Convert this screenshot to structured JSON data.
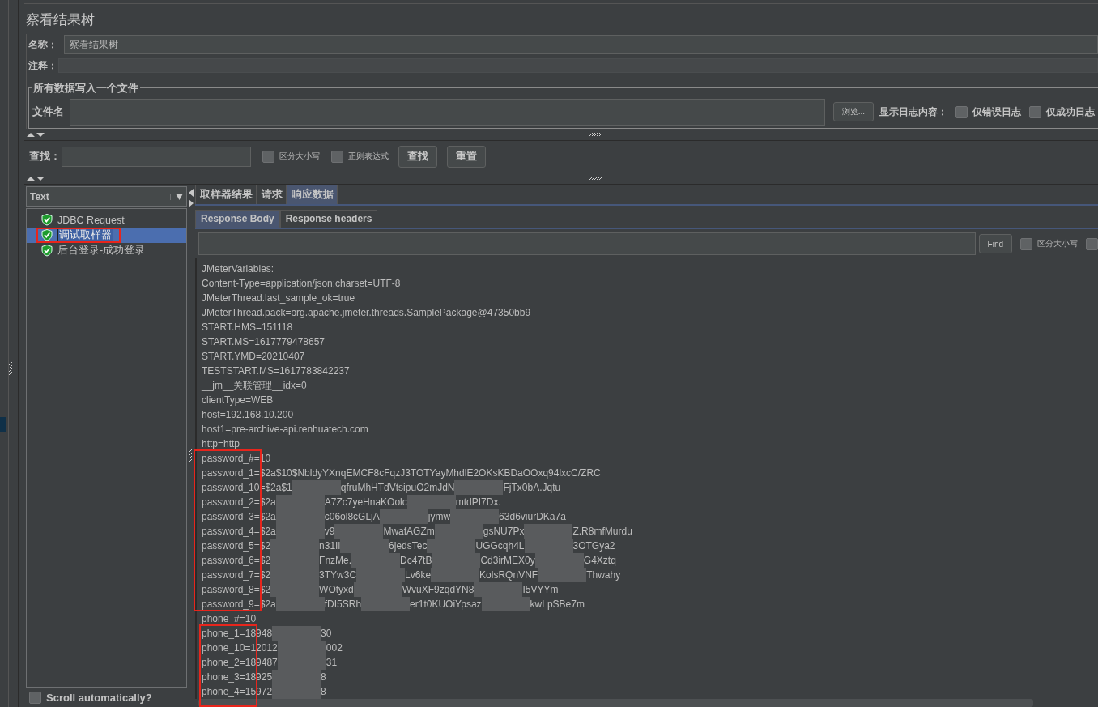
{
  "title": "察看结果树",
  "name_field": {
    "label": "名称：",
    "value": "察看结果树"
  },
  "comment_field": {
    "label": "注释："
  },
  "file_group": {
    "legend": "所有数据写入一个文件",
    "label": "文件名",
    "browse_button": "浏览...",
    "log_label": "显示日志内容：",
    "options": [
      {
        "label": "仅错误日志",
        "checked": false
      },
      {
        "label": "仅成功日志",
        "checked": false
      }
    ]
  },
  "search": {
    "label": "查找：",
    "options": [
      {
        "label": "区分大小写",
        "checked": false
      },
      {
        "label": "正则表达式",
        "checked": false
      }
    ],
    "buttons": [
      "查找",
      "重置"
    ]
  },
  "renderer": {
    "value": "Text"
  },
  "tree": [
    {
      "label": "JDBC Request",
      "passed": true,
      "selected": false,
      "highlighted": false
    },
    {
      "label": "调试取样器",
      "passed": true,
      "selected": true,
      "highlighted": true
    },
    {
      "label": "后台登录-成功登录",
      "passed": true,
      "selected": false,
      "highlighted": false
    }
  ],
  "scroll_auto": {
    "label": "Scroll automatically?",
    "checked": false
  },
  "tabs": [
    {
      "label": "取样器结果",
      "selected": false
    },
    {
      "label": "请求",
      "selected": false
    },
    {
      "label": "响应数据",
      "selected": true
    }
  ],
  "subtabs": [
    {
      "label": "Response Body",
      "selected": true
    },
    {
      "label": "Response headers",
      "selected": false
    }
  ],
  "find": {
    "button": "Find",
    "options": [
      {
        "label": "区分大小写",
        "checked": false
      },
      {
        "checked": false
      }
    ]
  },
  "response_blocks": [
    {
      "marked": false,
      "lines": [
        {
          "parts": [
            "JMeterVariables:"
          ]
        },
        {
          "parts": [
            "Content-Type=application/json;charset=UTF-8"
          ]
        },
        {
          "parts": [
            "JMeterThread.last_sample_ok=true"
          ]
        },
        {
          "parts": [
            "JMeterThread.pack=org.apache.jmeter.threads.SamplePackage@47350bb9"
          ]
        },
        {
          "parts": [
            "START.HMS=151118"
          ]
        },
        {
          "parts": [
            "START.MS=1617779478657"
          ]
        },
        {
          "parts": [
            "START.YMD=20210407"
          ]
        },
        {
          "parts": [
            "TESTSTART.MS=1617783842237"
          ]
        },
        {
          "parts": [
            "__jm__关联管理__idx=0"
          ]
        },
        {
          "parts": [
            "clientType=WEB"
          ]
        },
        {
          "parts": [
            "host=192.168.10.200"
          ]
        },
        {
          "parts": [
            "host1=pre-archive-api.renhuatech.com"
          ]
        },
        {
          "parts": [
            "http=http"
          ]
        }
      ]
    },
    {
      "marked": true,
      "lines": [
        {
          "parts": [
            "password_#=10"
          ]
        },
        {
          "parts": [
            "password_1=$2a$10$NbldyYXnqEMCF8cFqzJ3TOTYayMhdlE2OKsKBDaOOxq94lxcC/ZRC"
          ]
        },
        {
          "parts": [
            "password_10=$2a$1",
            "qfruMhHTdVtsipuO2mJdN",
            "FjTx0bA.Jqtu"
          ]
        },
        {
          "parts": [
            "password_2=$2a",
            "A7Zc7yeHnaKOolc",
            "mtdPI7Dx."
          ]
        },
        {
          "parts": [
            "password_3=$2a",
            "c06ol8cGLjA",
            "jymw",
            "63d6viurDKa7a"
          ]
        },
        {
          "parts": [
            "password_4=$2a",
            "v9",
            "MwafAGZm",
            "gsNU7Px",
            "Z.R8mfMurdu"
          ]
        },
        {
          "parts": [
            "password_5=$2",
            "n31Il",
            "6jedsTec",
            "UGGcqh4L",
            "3OTGya2"
          ]
        },
        {
          "parts": [
            "password_6=$2",
            "FnzMe.",
            "Dc47tB",
            "Cd3irMEX0y",
            "G4Xztq"
          ]
        },
        {
          "parts": [
            "password_7=$2",
            "3TYw3C",
            "Lv6ke",
            "KolsRQnVNF",
            "Thwahy"
          ]
        },
        {
          "parts": [
            "password_8=$2",
            "WOtyxd",
            "WvuXF9zqdYN8",
            "I5VYYm"
          ]
        },
        {
          "parts": [
            "password_9=$2a",
            "fDI5SRh",
            "er1t0KUOiYpsaz",
            "kwLpSBe7m"
          ]
        }
      ]
    },
    {
      "marked": false,
      "lines": [
        {
          "parts": [
            "phone_#=10"
          ]
        }
      ]
    },
    {
      "marked": true,
      "lines": [
        {
          "parts": [
            "phone_1=18948",
            "30"
          ]
        },
        {
          "parts": [
            "phone_10=12012",
            "002"
          ]
        },
        {
          "parts": [
            "phone_2=189487",
            "31"
          ]
        },
        {
          "parts": [
            "phone_3=18925",
            "8"
          ]
        },
        {
          "parts": [
            "phone_4=15972",
            "8"
          ]
        }
      ]
    }
  ]
}
